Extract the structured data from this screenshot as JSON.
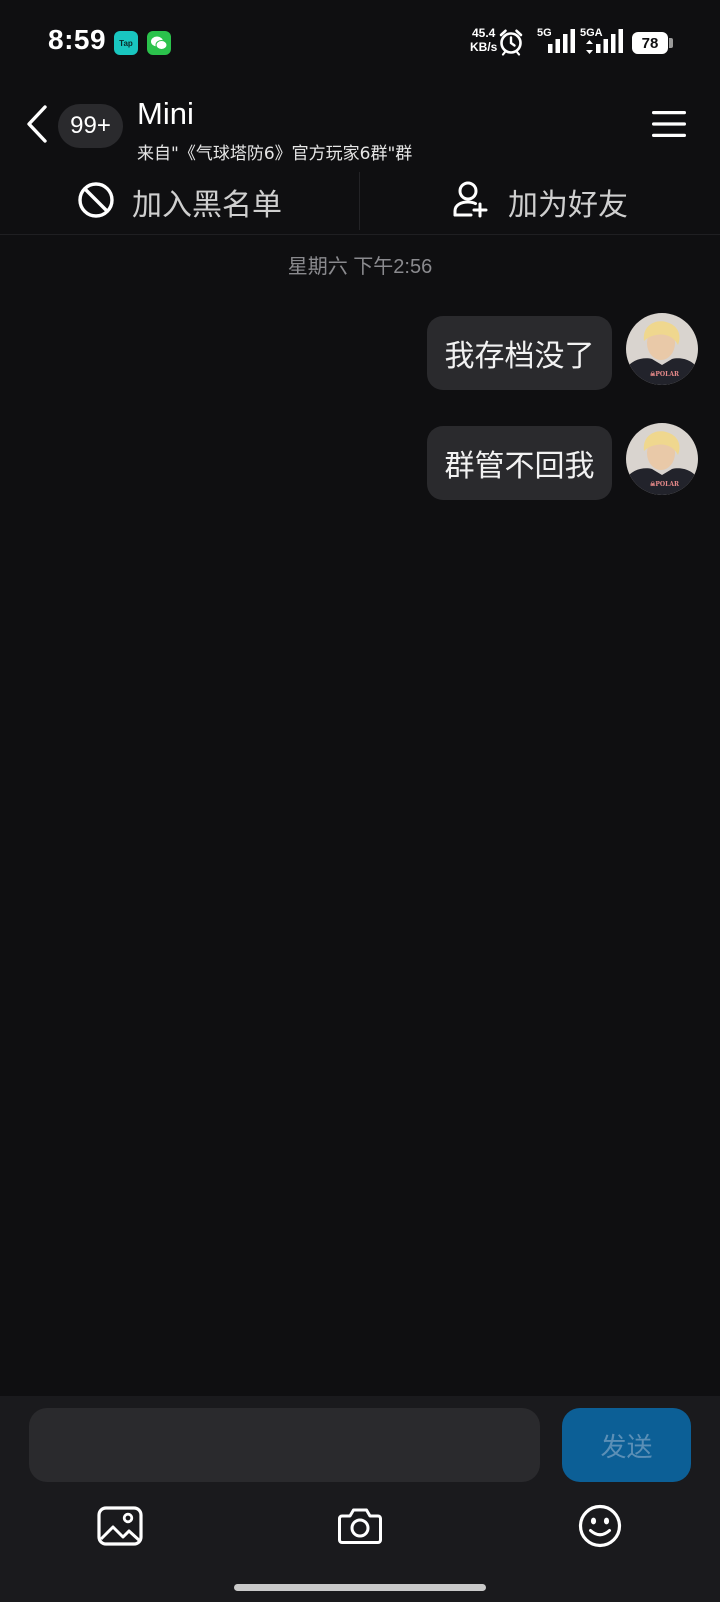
{
  "status_bar": {
    "time": "8:59",
    "app_badges": [
      "Tap",
      "WeChat"
    ],
    "net_speed_value": "45.4",
    "net_speed_unit": "KB/s",
    "sim1_label": "5G",
    "sim2_label": "5GA",
    "battery": "78"
  },
  "header": {
    "unread_count": "99+",
    "title": "Mini",
    "subtitle": "来自\"《气球塔防6》官方玩家6群\"群"
  },
  "actions": {
    "blacklist_label": "加入黑名单",
    "add_friend_label": "加为好友"
  },
  "conversation": {
    "timestamp": "星期六 下午2:56",
    "messages": [
      {
        "text": "我存档没了",
        "sender": "self"
      },
      {
        "text": "群管不回我",
        "sender": "self"
      }
    ]
  },
  "composer": {
    "input_value": "",
    "input_placeholder": "",
    "send_label": "发送"
  },
  "icons": {
    "back": "chevron-left-icon",
    "menu": "hamburger-menu-icon",
    "blacklist": "block-icon",
    "add_friend": "add-user-icon",
    "image": "image-icon",
    "camera": "camera-icon",
    "emoji": "emoji-icon"
  },
  "colors": {
    "background": "#0f0f11",
    "bubble": "#2a2a2d",
    "send_button": "#0c5f96",
    "input_panel": "#1a1a1d"
  }
}
